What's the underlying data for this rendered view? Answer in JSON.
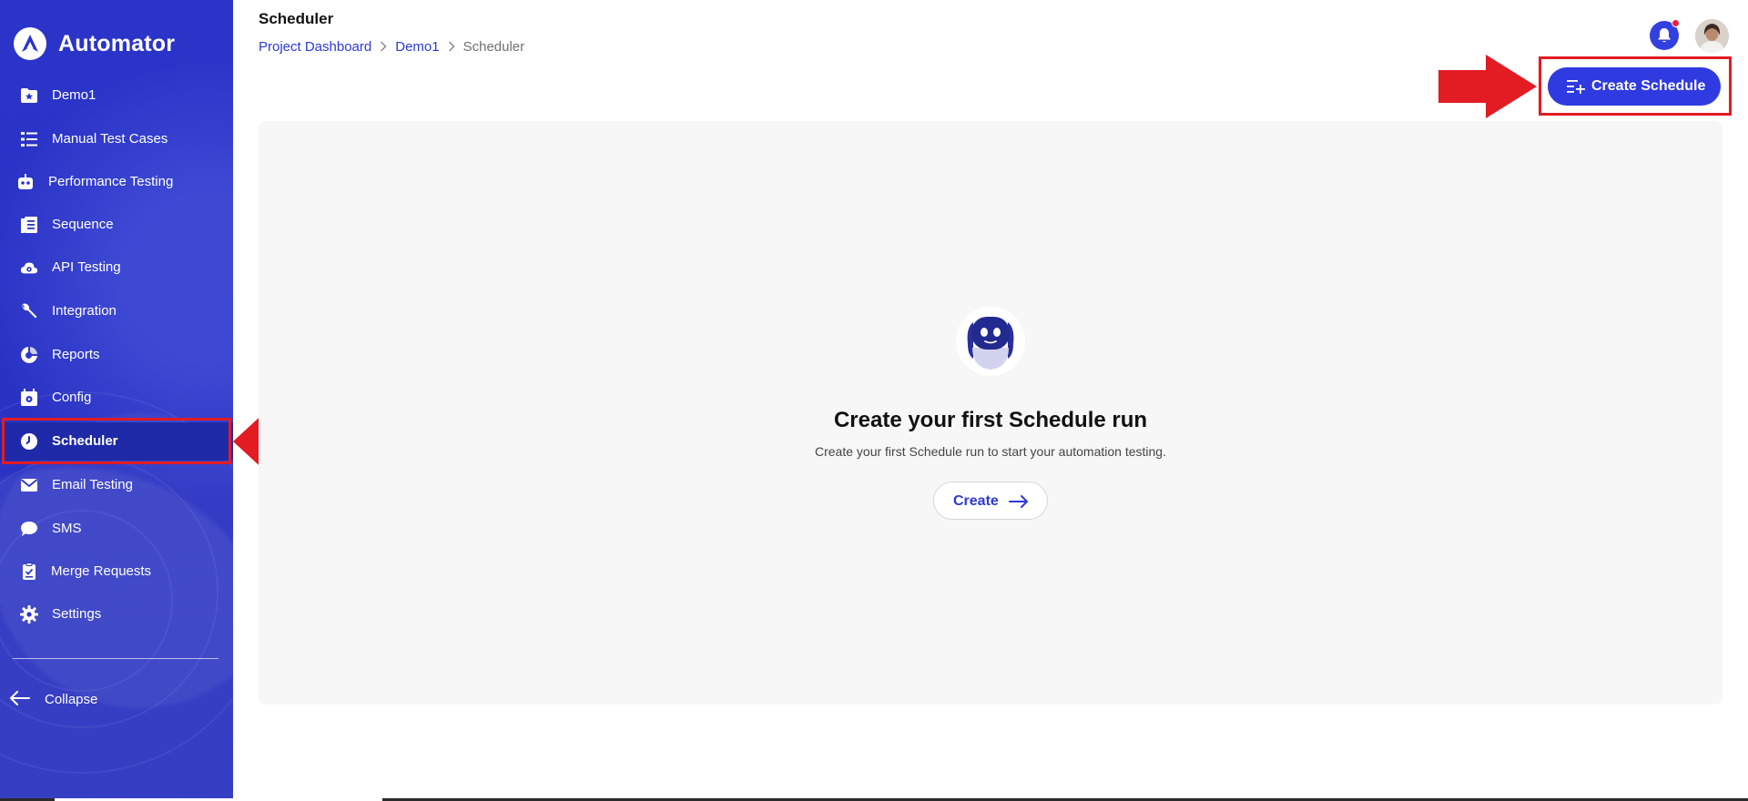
{
  "app": {
    "name": "Automator"
  },
  "sidebar": {
    "items": [
      {
        "label": "Demo1",
        "icon": "folder-star-icon"
      },
      {
        "label": "Manual Test Cases",
        "icon": "list-icon"
      },
      {
        "label": "Performance Testing",
        "icon": "robot-icon"
      },
      {
        "label": "Sequence",
        "icon": "document-stack-icon"
      },
      {
        "label": "API Testing",
        "icon": "cloud-gear-icon"
      },
      {
        "label": "Integration",
        "icon": "wrench-icon"
      },
      {
        "label": "Reports",
        "icon": "pie-chart-icon"
      },
      {
        "label": "Config",
        "icon": "calendar-gear-icon"
      },
      {
        "label": "Scheduler",
        "icon": "clock-icon",
        "active": true
      },
      {
        "label": "Email Testing",
        "icon": "envelope-icon"
      },
      {
        "label": "SMS",
        "icon": "chat-bubble-icon"
      },
      {
        "label": "Merge Requests",
        "icon": "clipboard-icon"
      },
      {
        "label": "Settings",
        "icon": "gear-icon"
      }
    ],
    "collapse_label": "Collapse"
  },
  "header": {
    "title": "Scheduler",
    "breadcrumb": [
      "Project Dashboard",
      "Demo1",
      "Scheduler"
    ],
    "create_schedule_label": "Create Schedule"
  },
  "empty_state": {
    "title": "Create your first Schedule run",
    "subtitle": "Create your first Schedule run to start your automation testing.",
    "button_label": "Create"
  },
  "colors": {
    "sidebar": "#2835c8",
    "accent": "#2f3ae0",
    "highlight": "#e31b23",
    "notification_dot": "#f0213a"
  }
}
